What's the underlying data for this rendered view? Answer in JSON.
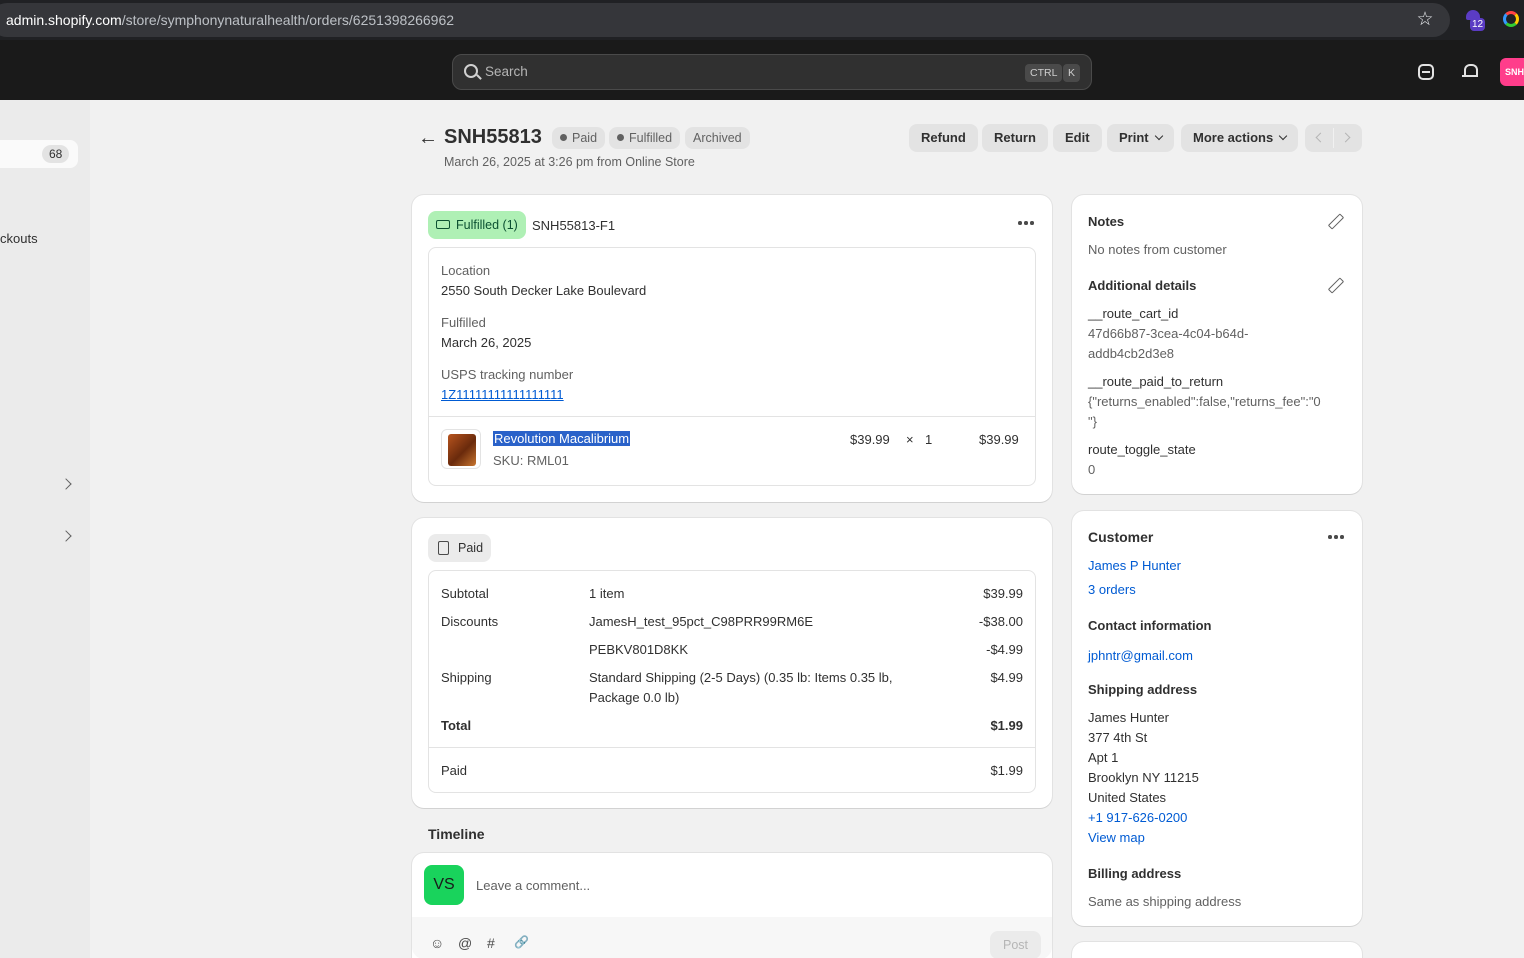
{
  "browser": {
    "url_host": "admin.shopify.com",
    "url_path": "/store/symphonynaturalhealth/orders/6251398266962",
    "extension_badge": "12"
  },
  "topbar": {
    "search_placeholder": "Search",
    "shortcut_ctrl": "CTRL",
    "shortcut_k": "K",
    "store_avatar": "SNH"
  },
  "leftnav": {
    "orders_count": "68",
    "checkouts_label": "ckouts"
  },
  "header": {
    "order_id": "SNH55813",
    "badges": [
      "Paid",
      "Fulfilled",
      "Archived"
    ],
    "subtitle": "March 26, 2025 at 3:26 pm from Online Store",
    "actions": [
      "Refund",
      "Return",
      "Edit",
      "Print",
      "More actions"
    ]
  },
  "fulfillment": {
    "badge": "Fulfilled (1)",
    "fulfillment_id": "SNH55813-F1",
    "location_label": "Location",
    "location_value": "2550 South Decker Lake Boulevard",
    "fulfilled_label": "Fulfilled",
    "fulfilled_value": "March 26, 2025",
    "tracking_label": "USPS tracking number",
    "tracking_value": "1Z11111111111111111",
    "item": {
      "name": "Revolution Macalibrium",
      "sku": "SKU: RML01",
      "price": "$39.99",
      "times": "×",
      "qty": "1",
      "total": "$39.99"
    }
  },
  "payment": {
    "badge": "Paid",
    "subtotal_label": "Subtotal",
    "subtotal_desc": "1 item",
    "subtotal_value": "$39.99",
    "discounts_label": "Discounts",
    "discount1_code": "JamesH_test_95pct_C98PRR99RM6E",
    "discount1_value": "-$38.00",
    "discount2_code": "PEBKV801D8KK",
    "discount2_value": "-$4.99",
    "shipping_label": "Shipping",
    "shipping_desc_line1": "Standard Shipping (2-5 Days) (0.35 lb: Items 0.35 lb,",
    "shipping_desc_line2": "Package 0.0 lb)",
    "shipping_value": "$4.99",
    "total_label": "Total",
    "total_value": "$1.99",
    "paid_label": "Paid",
    "paid_value": "$1.99"
  },
  "timeline": {
    "title": "Timeline",
    "avatar_initials": "VS",
    "comment_placeholder": "Leave a comment...",
    "post_label": "Post",
    "tools": [
      "☺",
      "@",
      "#",
      "🔗"
    ]
  },
  "notes": {
    "title": "Notes",
    "body": "No notes from customer",
    "additional_title": "Additional details",
    "attr1_key": "__route_cart_id",
    "attr1_value_line1": "47d66b87-3cea-4c04-b64d-",
    "attr1_value_line2": "addb4cb2d3e8",
    "attr2_key": "__route_paid_to_return",
    "attr2_value_line1": "{\"returns_enabled\":false,\"returns_fee\":\"0",
    "attr2_value_line2": "\"}",
    "attr3_key": "route_toggle_state",
    "attr3_value": "0"
  },
  "customer": {
    "title": "Customer",
    "name": "James P Hunter",
    "orders": "3 orders",
    "contact_title": "Contact information",
    "email": "jphntr@gmail.com",
    "shipping_title": "Shipping address",
    "address": [
      "James Hunter",
      "377 4th St",
      "Apt 1",
      "Brooklyn NY 11215",
      "United States"
    ],
    "phone": "+1 917-626-0200",
    "view_map": "View map",
    "billing_title": "Billing address",
    "billing_value": "Same as shipping address"
  }
}
